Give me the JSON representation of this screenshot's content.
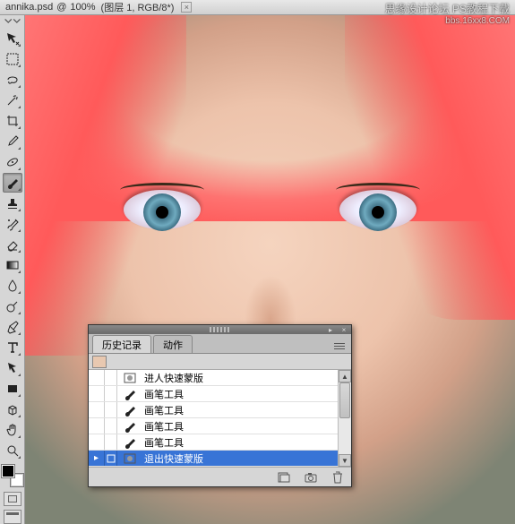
{
  "titlebar": {
    "filename": "annika.psd",
    "zoom": "100%",
    "layer_info": "(图层 1, RGB/8*)",
    "close_glyph": "×"
  },
  "watermark": {
    "line1": "思缘设计论坛 PS教程下载",
    "line2": "bbs.16xx8.COM"
  },
  "tools": [
    {
      "name": "move-tool",
      "glyph": "move"
    },
    {
      "name": "marquee-tool",
      "glyph": "marquee"
    },
    {
      "name": "lasso-tool",
      "glyph": "lasso"
    },
    {
      "name": "wand-tool",
      "glyph": "wand"
    },
    {
      "name": "crop-tool",
      "glyph": "crop"
    },
    {
      "name": "eyedropper-tool",
      "glyph": "eyedropper"
    },
    {
      "name": "healing-tool",
      "glyph": "bandage"
    },
    {
      "name": "brush-tool",
      "glyph": "brush",
      "selected": true
    },
    {
      "name": "stamp-tool",
      "glyph": "stamp"
    },
    {
      "name": "history-brush-tool",
      "glyph": "hbrush"
    },
    {
      "name": "eraser-tool",
      "glyph": "eraser"
    },
    {
      "name": "gradient-tool",
      "glyph": "gradient"
    },
    {
      "name": "blur-tool",
      "glyph": "droplet"
    },
    {
      "name": "dodge-tool",
      "glyph": "dodge"
    },
    {
      "name": "pen-tool",
      "glyph": "pen"
    },
    {
      "name": "type-tool",
      "glyph": "type"
    },
    {
      "name": "path-select-tool",
      "glyph": "pathselect"
    },
    {
      "name": "shape-tool",
      "glyph": "rect"
    },
    {
      "name": "3d-tool",
      "glyph": "cube"
    },
    {
      "name": "hand-tool",
      "glyph": "hand"
    },
    {
      "name": "zoom-tool",
      "glyph": "zoom"
    }
  ],
  "history_panel": {
    "tabs": [
      {
        "label": "历史记录",
        "active": true
      },
      {
        "label": "动作",
        "active": false
      }
    ],
    "items": [
      {
        "icon": "quickmask",
        "label": "进人快速蒙版"
      },
      {
        "icon": "brush",
        "label": "画笔工具"
      },
      {
        "icon": "brush",
        "label": "画笔工具"
      },
      {
        "icon": "brush",
        "label": "画笔工具"
      },
      {
        "icon": "brush",
        "label": "画笔工具"
      },
      {
        "icon": "quickmask",
        "label": "退出快速蒙版",
        "current": true
      }
    ],
    "footer_icons": [
      "new-doc-from-state-icon",
      "snapshot-icon",
      "trash-icon"
    ]
  }
}
